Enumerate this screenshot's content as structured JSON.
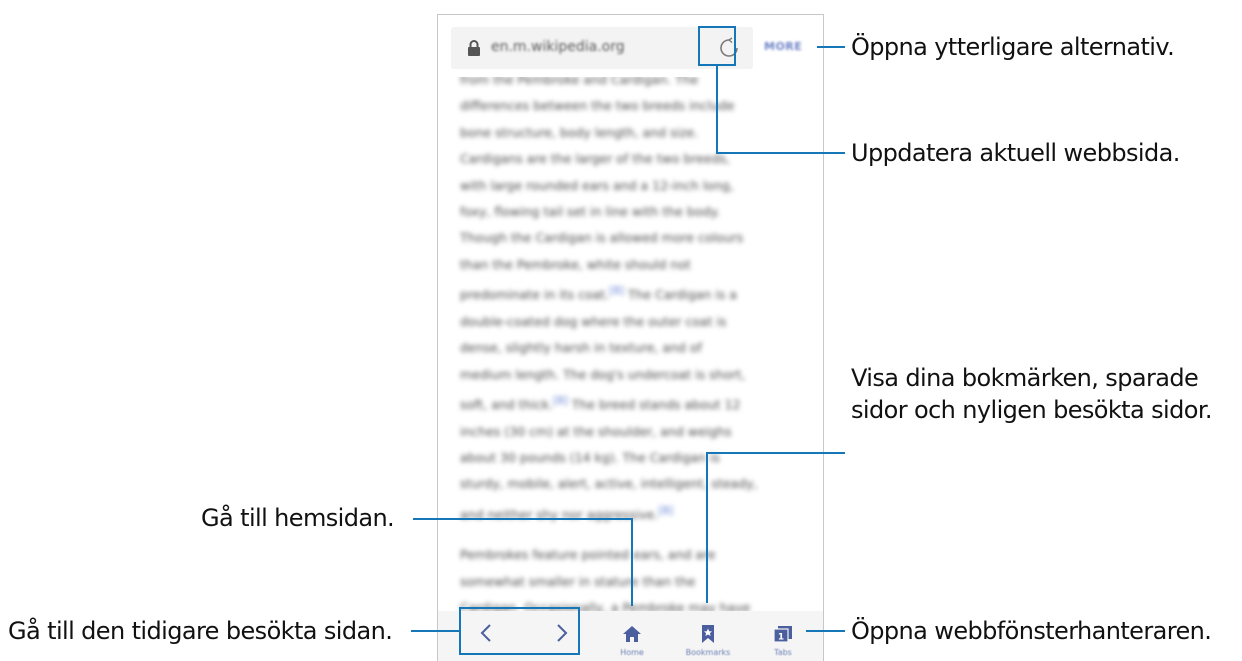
{
  "browser": {
    "url": "en.m.wikipedia.org",
    "more_label": "MORE",
    "article": {
      "paragraph1": [
        "from the Pembroke and Cardigan. The",
        "differences between the two breeds include",
        "bone structure, body length, and size.",
        "Cardigans are the larger of the two breeds,",
        "with large rounded ears and a 12-inch long,",
        "foxy, flowing tail set in line with the body.",
        "Though the Cardigan is allowed more colours",
        "than the Pembroke, white should not",
        "predominate in its coat.",
        "double-coated dog where the outer coat is",
        "dense, slightly harsh in texture, and of",
        "medium length. The dog's undercoat is short,",
        "soft, and thick.",
        "inches (30 cm) at the shoulder, and weighs",
        "about 30 pounds (14 kg). The Cardigan is",
        "sturdy, mobile, alert, active, intelligent, steady,",
        "and neither shy nor aggressive."
      ],
      "ref1": "[8]",
      "ref1_tail": " The Cardigan is a",
      "ref2": "[8]",
      "ref2_tail": " The breed stands about 12",
      "ref3": "[8]",
      "paragraph2": [
        "Pembrokes feature pointed ears, and are",
        "somewhat smaller in stature than the",
        "Cardigan. Occasionally, a Pembroke may have"
      ]
    },
    "bottom_bar": {
      "home_label": "Home",
      "bookmarks_label": "Bookmarks",
      "tabs_label": "Tabs",
      "tabs_count": "1"
    }
  },
  "callouts": {
    "more": "Öppna ytterligare alternativ.",
    "reload": "Uppdatera aktuell webbsida.",
    "bookmarks_line1": "Visa dina bokmärken, sparade",
    "bookmarks_line2": "sidor och nyligen besökta sidor.",
    "home": "Gå till hemsidan.",
    "back_forward": "Gå till den tidigare besökta sidan.",
    "tabs": "Öppna webbfönsterhanteraren."
  },
  "colors": {
    "callout_line": "#1577b7",
    "link": "#5a7bd2",
    "toolbar_icon": "#4b5f9e"
  }
}
